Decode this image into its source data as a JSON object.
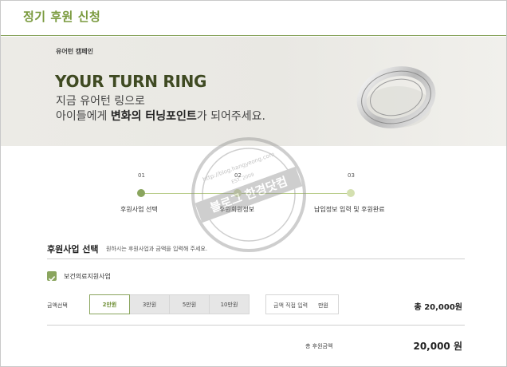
{
  "header": {
    "title": "정기 후원 신청"
  },
  "banner": {
    "kicker": "유어턴 캠페인",
    "title": "YOUR TURN RING",
    "line1": "지금 유어턴 링으로",
    "line2_pre": "아이들에게 ",
    "line2_bold": "변화의 터닝포인트",
    "line2_post": "가 되어주세요."
  },
  "steps": [
    {
      "num": "01",
      "label": "후원사업 선택",
      "active": true
    },
    {
      "num": "02",
      "label": "후원회원정보",
      "active": false
    },
    {
      "num": "03",
      "label": "납입정보 입력 및 후원완료",
      "active": false
    }
  ],
  "section": {
    "title": "후원사업 선택",
    "hint": "원하시는 후원사업과 금액을 입력해 주세요."
  },
  "program": {
    "label": "보건의료지원사업",
    "checked": true
  },
  "amount": {
    "label": "금액선택",
    "options": [
      "2만원",
      "3만원",
      "5만원",
      "10만원"
    ],
    "selected": "2만원",
    "custom_placeholder": "금액 직접 입력",
    "custom_unit": "만원",
    "line_total": "총 20,000원"
  },
  "summary": {
    "label": "총 후원금액",
    "value": "20,000 원"
  },
  "watermark": {
    "text_top": "http://blog.hangyeong.com",
    "text_main": "블로그 한경닷컴",
    "year": "EST. 2009"
  },
  "colors": {
    "accent": "#8aa55e",
    "accent_light": "#d4e0b0",
    "banner_bg": "#ebeae5"
  },
  "icons": {
    "check": "checkbox-check-icon"
  }
}
